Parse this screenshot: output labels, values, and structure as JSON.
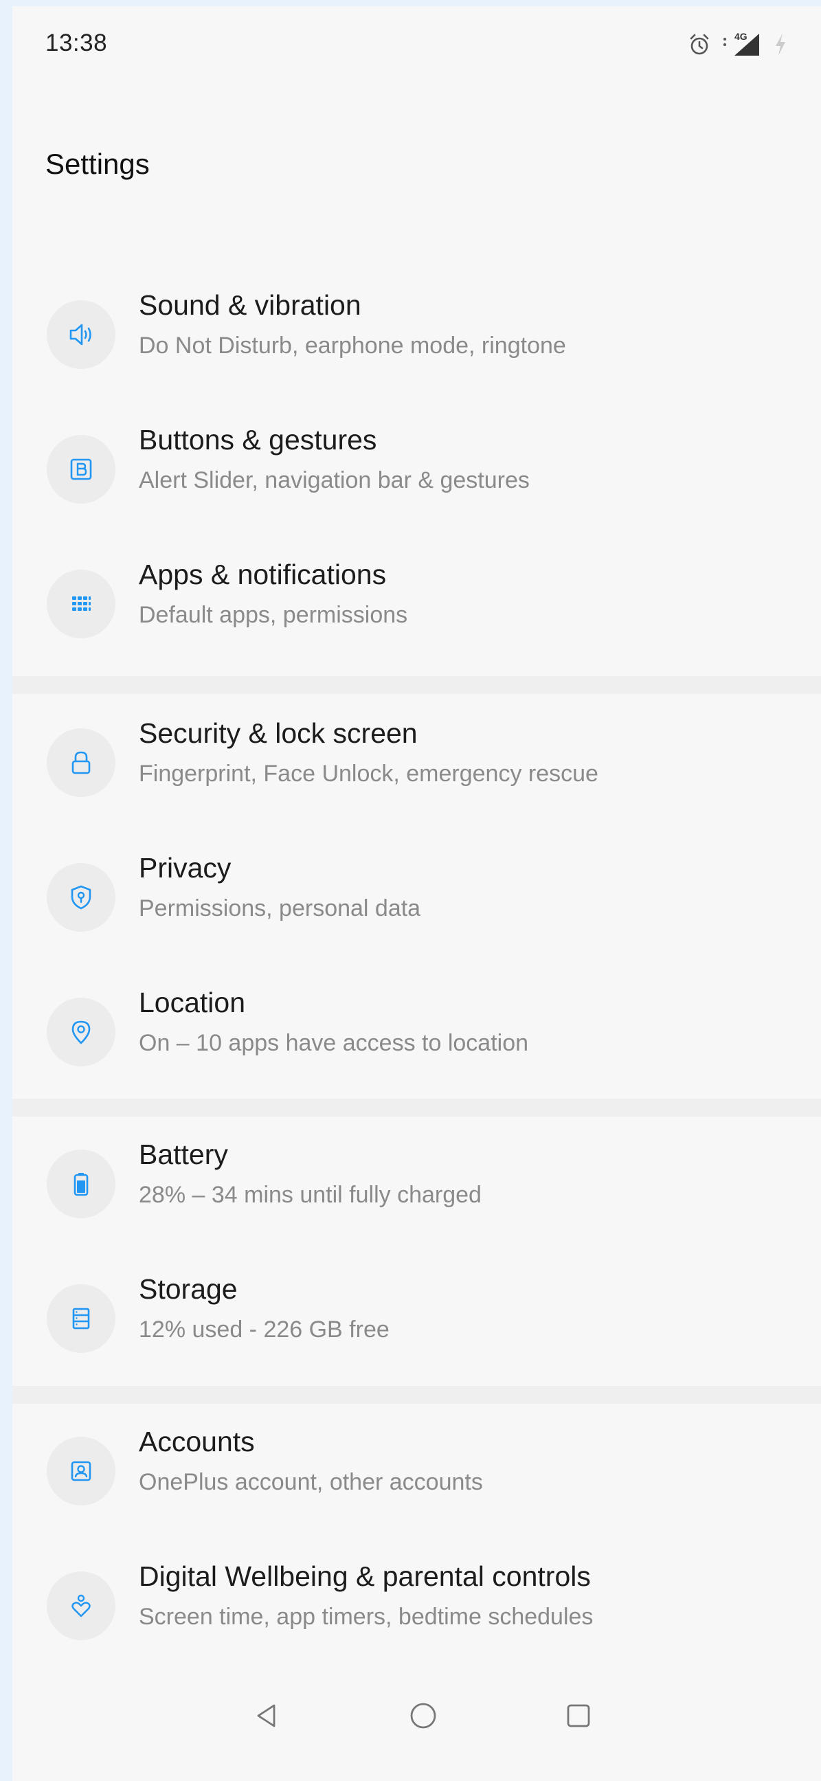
{
  "status_bar": {
    "time": "13:38",
    "network_label": "4G",
    "icons": [
      "alarm-icon",
      "signal-icon",
      "charging-icon"
    ]
  },
  "header": {
    "title": "Settings"
  },
  "accent_color": "#2196f3",
  "settings": {
    "items": [
      {
        "icon": "speaker-icon",
        "title": "Sound & vibration",
        "subtitle": "Do Not Disturb, earphone mode, ringtone"
      },
      {
        "icon": "button-b-icon",
        "title": "Buttons & gestures",
        "subtitle": "Alert Slider, navigation bar & gestures"
      },
      {
        "icon": "apps-grid-icon",
        "title": "Apps & notifications",
        "subtitle": "Default apps, permissions"
      },
      {
        "icon": "lock-icon",
        "title": "Security & lock screen",
        "subtitle": "Fingerprint, Face Unlock, emergency rescue"
      },
      {
        "icon": "shield-icon",
        "title": "Privacy",
        "subtitle": "Permissions, personal data"
      },
      {
        "icon": "location-pin-icon",
        "title": "Location",
        "subtitle": "On – 10 apps have access to location"
      },
      {
        "icon": "battery-icon",
        "title": "Battery",
        "subtitle": "28% – 34 mins until fully charged"
      },
      {
        "icon": "storage-icon",
        "title": "Storage",
        "subtitle": "12% used - 226 GB free"
      },
      {
        "icon": "account-icon",
        "title": "Accounts",
        "subtitle": "OnePlus account, other accounts"
      },
      {
        "icon": "wellbeing-icon",
        "title": "Digital Wellbeing & parental controls",
        "subtitle": "Screen time, app timers, bedtime schedules"
      }
    ]
  },
  "nav_bar": {
    "buttons": [
      "back-icon",
      "home-icon",
      "recents-icon"
    ]
  }
}
